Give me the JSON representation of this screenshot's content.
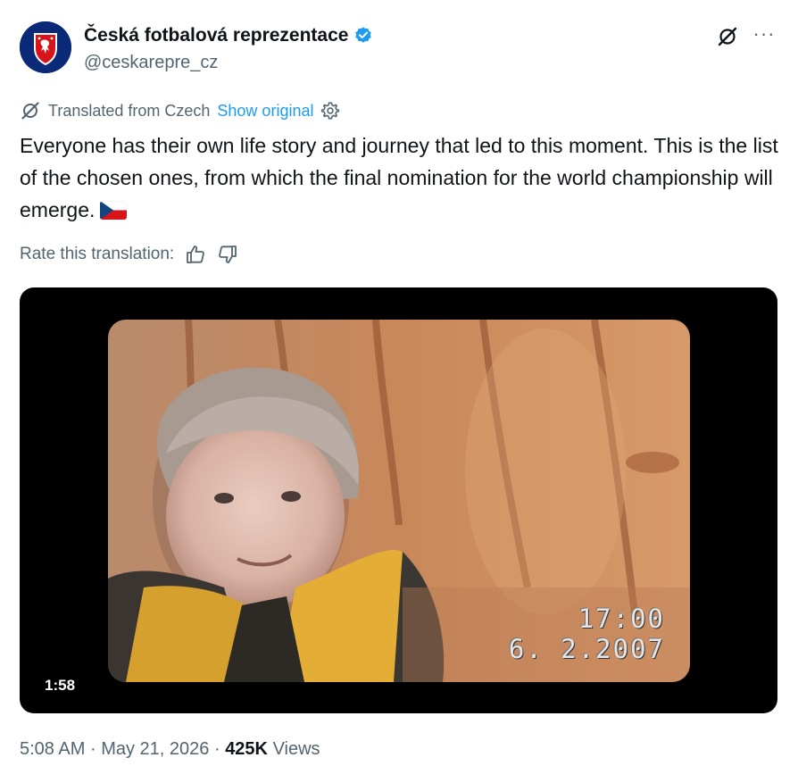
{
  "author": {
    "display_name": "Česká fotbalová reprezentace",
    "handle": "@ceskarepre_cz",
    "verified": true,
    "avatar_icon": "czech-lion-crest-icon",
    "avatar_color": "#0a2a78"
  },
  "header_actions": {
    "grok_icon": "grok-slash-icon",
    "more_label": "···"
  },
  "translation": {
    "label": "Translated from Czech",
    "show_original": "Show original",
    "settings_icon": "gear-icon"
  },
  "tweet": {
    "text": "Everyone has their own life story and journey that led to this moment. This is the list of the chosen ones, from which the final nomination for the world championship will emerge.",
    "emoji_icon": "czech-flag-icon"
  },
  "rating": {
    "label": "Rate this translation:",
    "up_icon": "thumbs-up-icon",
    "down_icon": "thumbs-down-icon"
  },
  "video": {
    "duration": "1:58",
    "osd_time": "17:00",
    "osd_date": "6. 2.2007"
  },
  "meta": {
    "time": "5:08 AM",
    "separator": "·",
    "date": "May 21, 2026",
    "views_count": "425K",
    "views_label": "Views"
  },
  "colors": {
    "accent": "#1d9bf0",
    "secondary_text": "#536471",
    "primary_text": "#0f1419"
  }
}
